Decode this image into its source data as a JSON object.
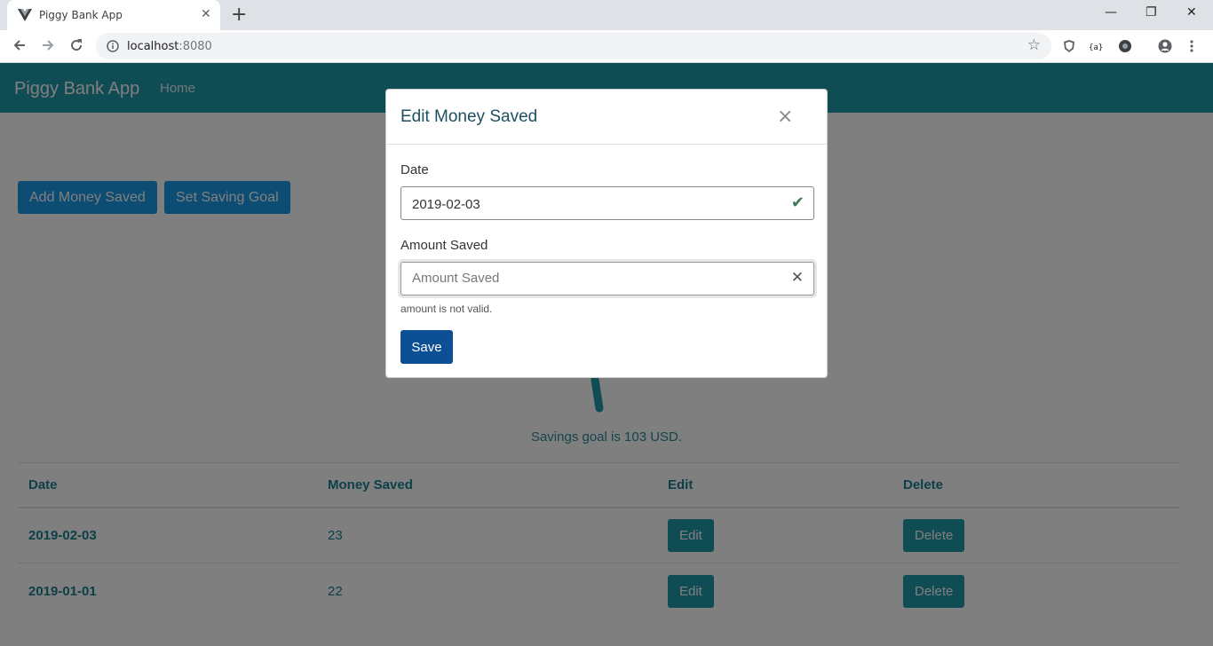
{
  "browser": {
    "tab_title": "Piggy Bank App",
    "tab_close": "✕",
    "new_tab": "+",
    "url_host": "localhost",
    "url_port": ":8080",
    "window_controls": {
      "minimize": "—",
      "restore": "❐",
      "close": "✕"
    },
    "icons": [
      "back-icon",
      "forward-icon",
      "reload-icon",
      "info-icon",
      "star-icon",
      "extension-icons",
      "profile-icon",
      "menu-icon"
    ]
  },
  "navbar": {
    "brand": "Piggy Bank App",
    "home": "Home",
    "color": "#2199a8"
  },
  "actions": {
    "add_money": "Add Money Saved",
    "set_goal": "Set Saving Goal"
  },
  "goal_text": "Savings goal is 103 USD.",
  "table": {
    "headers": [
      "Date",
      "Money Saved",
      "Edit",
      "Delete"
    ],
    "rows": [
      {
        "date": "2019-02-03",
        "amount": "23",
        "edit": "Edit",
        "delete": "Delete"
      },
      {
        "date": "2019-01-01",
        "amount": "22",
        "edit": "Edit",
        "delete": "Delete"
      }
    ]
  },
  "modal": {
    "title": "Edit Money Saved",
    "close": "×",
    "date_label": "Date",
    "date_value": "2019-02-03",
    "date_valid_icon": "✔",
    "amount_label": "Amount Saved",
    "amount_placeholder": "Amount Saved",
    "amount_value": "",
    "amount_invalid_icon": "✕",
    "feedback": "amount is not valid.",
    "save": "Save"
  }
}
